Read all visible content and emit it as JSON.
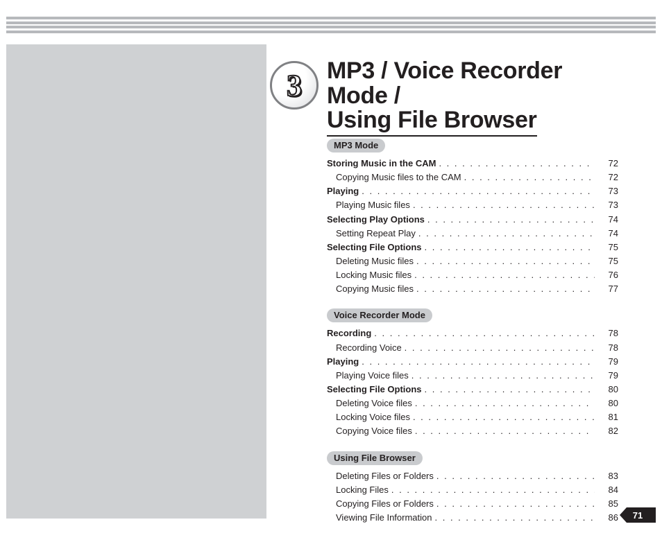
{
  "chapter": {
    "number": "3",
    "title_line1": "MP3 / Voice Recorder Mode /",
    "title_line2": "Using File Browser"
  },
  "page_number": "71",
  "sections": [
    {
      "label": "MP3 Mode",
      "rows": [
        {
          "level": 1,
          "title": "Storing Music in the CAM",
          "page": "72"
        },
        {
          "level": 2,
          "title": "Copying Music files to the CAM",
          "page": "72"
        },
        {
          "level": 1,
          "title": "Playing",
          "page": "73"
        },
        {
          "level": 2,
          "title": "Playing Music files",
          "page": "73"
        },
        {
          "level": 1,
          "title": "Selecting Play Options",
          "page": "74"
        },
        {
          "level": 2,
          "title": "Setting Repeat Play",
          "page": "74"
        },
        {
          "level": 1,
          "title": "Selecting File Options",
          "page": "75"
        },
        {
          "level": 2,
          "title": "Deleting Music files",
          "page": "75"
        },
        {
          "level": 2,
          "title": "Locking Music files",
          "page": "76"
        },
        {
          "level": 2,
          "title": "Copying Music files",
          "page": "77"
        }
      ]
    },
    {
      "label": "Voice Recorder Mode",
      "rows": [
        {
          "level": 1,
          "title": "Recording",
          "page": "78"
        },
        {
          "level": 2,
          "title": "Recording Voice",
          "page": "78"
        },
        {
          "level": 1,
          "title": "Playing",
          "page": "79"
        },
        {
          "level": 2,
          "title": "Playing Voice files",
          "page": "79"
        },
        {
          "level": 1,
          "title": "Selecting File Options",
          "page": "80"
        },
        {
          "level": 2,
          "title": "Deleting Voice files",
          "page": "80"
        },
        {
          "level": 2,
          "title": "Locking Voice files",
          "page": "81"
        },
        {
          "level": 2,
          "title": "Copying Voice files",
          "page": "82"
        }
      ]
    },
    {
      "label": "Using File Browser",
      "rows": [
        {
          "level": 2,
          "title": "Deleting Files or Folders",
          "page": "83"
        },
        {
          "level": 2,
          "title": "Locking Files",
          "page": "84"
        },
        {
          "level": 2,
          "title": "Copying Files or Folders",
          "page": "85"
        },
        {
          "level": 2,
          "title": "Viewing File Information",
          "page": "86"
        }
      ]
    }
  ]
}
